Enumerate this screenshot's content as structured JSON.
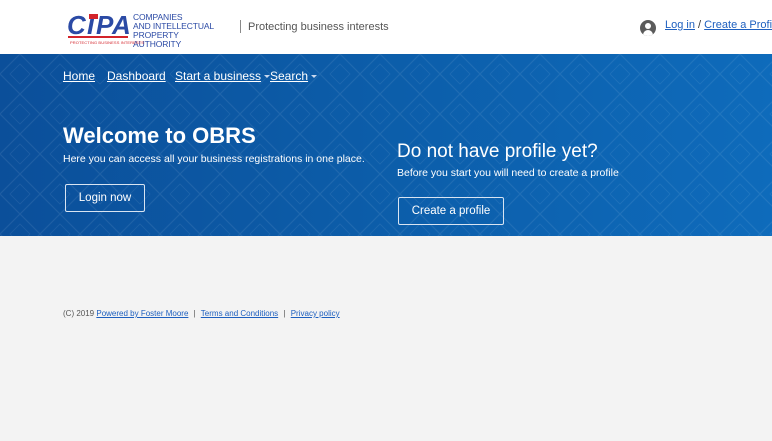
{
  "header": {
    "logo_mark": "CIPA",
    "logo_text": [
      "COMPANIES",
      "AND INTELLECTUAL",
      "PROPERTY AUTHORITY"
    ],
    "logo_tagline": "PROTECTING BUSINESS INTERESTS",
    "tagline": "Protecting business interests",
    "login_label": "Log in",
    "auth_separator": "/",
    "create_profile_label": "Create a Profile"
  },
  "nav": {
    "home": "Home",
    "dashboard": "Dashboard",
    "start_business": "Start a business",
    "search": "Search"
  },
  "hero": {
    "welcome_title": "Welcome to OBRS",
    "welcome_sub": "Here you can access all your business registrations in one place.",
    "login_button": "Login now",
    "profile_title": "Do not have profile yet?",
    "profile_sub": "Before you start you will need to create a profile",
    "create_button": "Create a profile"
  },
  "footer": {
    "copyright": "(C) 2019",
    "powered_by": "Powered by Foster Moore",
    "separator": "|",
    "terms": "Terms and Conditions",
    "privacy": "Privacy policy"
  },
  "colors": {
    "hero_blue": "#0c5ca8",
    "link_blue": "#1d5fbf",
    "logo_red": "#d3232a",
    "logo_blue": "#2b4aa5"
  },
  "icons": {
    "user": "user-avatar-icon",
    "dropdown": "caret-down-icon"
  }
}
